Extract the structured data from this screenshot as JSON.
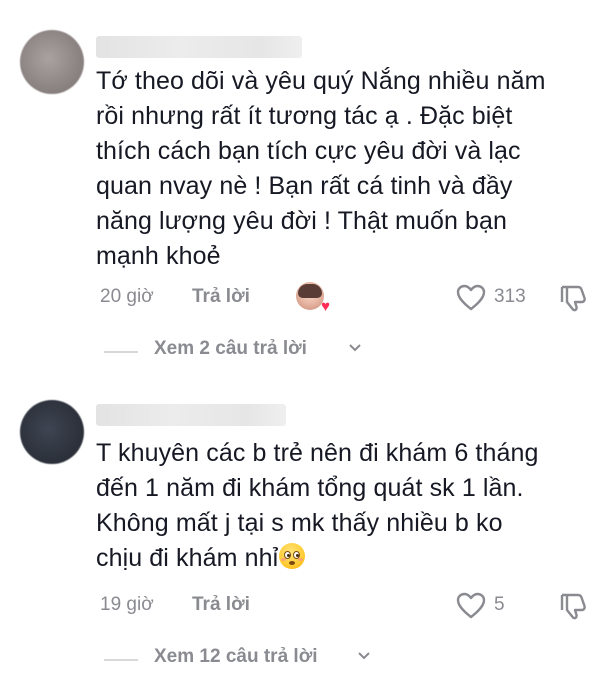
{
  "comments": [
    {
      "lines": [
        "Tớ theo dõi và yêu quý Nắng nhiều năm",
        "rồi nhưng rất ít tương tác ạ . Đặc biệt",
        "thích cách bạn tích cực yêu đời và lạc",
        "quan nvay nè ! Bạn rất cá tinh và đầy",
        "năng lượng yêu đời ! Thật muốn bạn",
        "mạnh khoẻ"
      ],
      "time": "20 giờ",
      "reply_label": "Trả lời",
      "likes": "313",
      "view_replies": "Xem 2 câu trả lời"
    },
    {
      "lines": [
        "T khuyên các b trẻ nên đi khám 6 tháng",
        "đến 1 năm đi khám tổng quát sk 1 lần.",
        "Không mất j tại s mk thấy nhiều b ko",
        "chịu đi khám nhỉ"
      ],
      "emoji": "flushed-face-emoji",
      "time": "19 giờ",
      "reply_label": "Trả lời",
      "likes": "5",
      "view_replies": "Xem 12 câu trả lời"
    }
  ],
  "colors": {
    "text": "#161823",
    "muted": "#8a8b91",
    "divider": "#d8d8da",
    "heart": "#fe2c55"
  },
  "icons": {
    "like": "heart-outline-icon",
    "dislike": "thumbs-down-icon",
    "expand": "chevron-down-icon",
    "creator_liked": "creator-avatar-heart-icon"
  }
}
